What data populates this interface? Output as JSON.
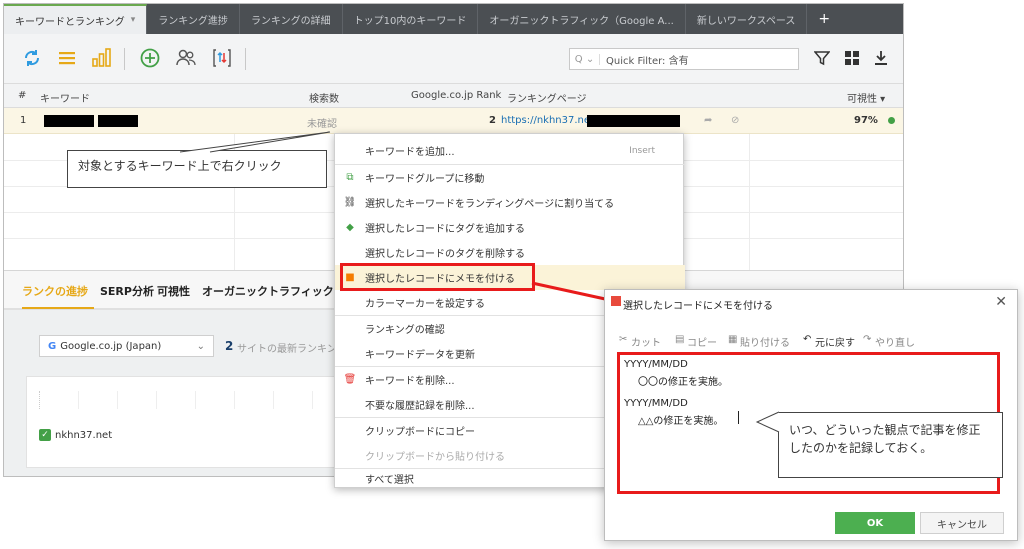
{
  "tabs": [
    {
      "label": "キーワードとランキング"
    },
    {
      "label": "ランキング進捗"
    },
    {
      "label": "ランキングの詳細"
    },
    {
      "label": "トップ10内のキーワード"
    },
    {
      "label": "オーガニックトラフィック（Google A..."
    },
    {
      "label": "新しいワークスペース"
    },
    {
      "label": "+"
    }
  ],
  "quick_filter": {
    "value": "Quick Filter: 含有"
  },
  "table": {
    "headers": {
      "num": "#",
      "keyword": "キーワード",
      "search": "検索数",
      "rank": "Google.co.jp Rank",
      "page": "ランキングページ",
      "vis": "可視性 ▾"
    },
    "row": {
      "num": "1",
      "search": "未確認",
      "rank": "2",
      "url": "https://nkhn37.net/",
      "vis": "97%"
    }
  },
  "callout1": "対象とするキーワード上で右クリック",
  "context_menu": {
    "add": "キーワードを追加...",
    "add_shortcut": "Insert",
    "move": "キーワードグループに移動",
    "assign": "選択したキーワードをランディングページに割り当てる",
    "addtag": "選択したレコードにタグを追加する",
    "deltag": "選択したレコードのタグを削除する",
    "memo": "選択したレコードにメモを付ける",
    "color": "カラーマーカーを設定する",
    "check": "ランキングの確認",
    "update": "キーワードデータを更新",
    "delete": "キーワードを削除...",
    "history": "不要な履歴記録を削除...",
    "copy": "クリップボードにコピー",
    "paste": "クリップボードから貼り付ける",
    "selall": "すべて選択"
  },
  "bottom": {
    "tabs": [
      "ランクの進捗",
      "SERP分析",
      "可視性",
      "オーガニックトラフィック(G..."
    ],
    "engine": "Google.co.jp (Japan)",
    "count": "2",
    "count_text": "サイトの最新ランキング",
    "site": "nkhn37.net"
  },
  "dialog": {
    "title": "選択したレコードにメモを付ける",
    "toolbar": {
      "cut": "カット",
      "copy": "コピー",
      "paste": "貼り付ける",
      "undo": "元に戻す",
      "redo": "やり直し"
    },
    "line1": "YYYY/MM/DD",
    "line2": "〇〇の修正を実施。",
    "line3": "YYYY/MM/DD",
    "line4": "△△の修正を実施。",
    "ok": "OK",
    "cancel": "キャンセル"
  },
  "callout2": "いつ、どういった観点で記事を修正したのかを記録しておく。"
}
